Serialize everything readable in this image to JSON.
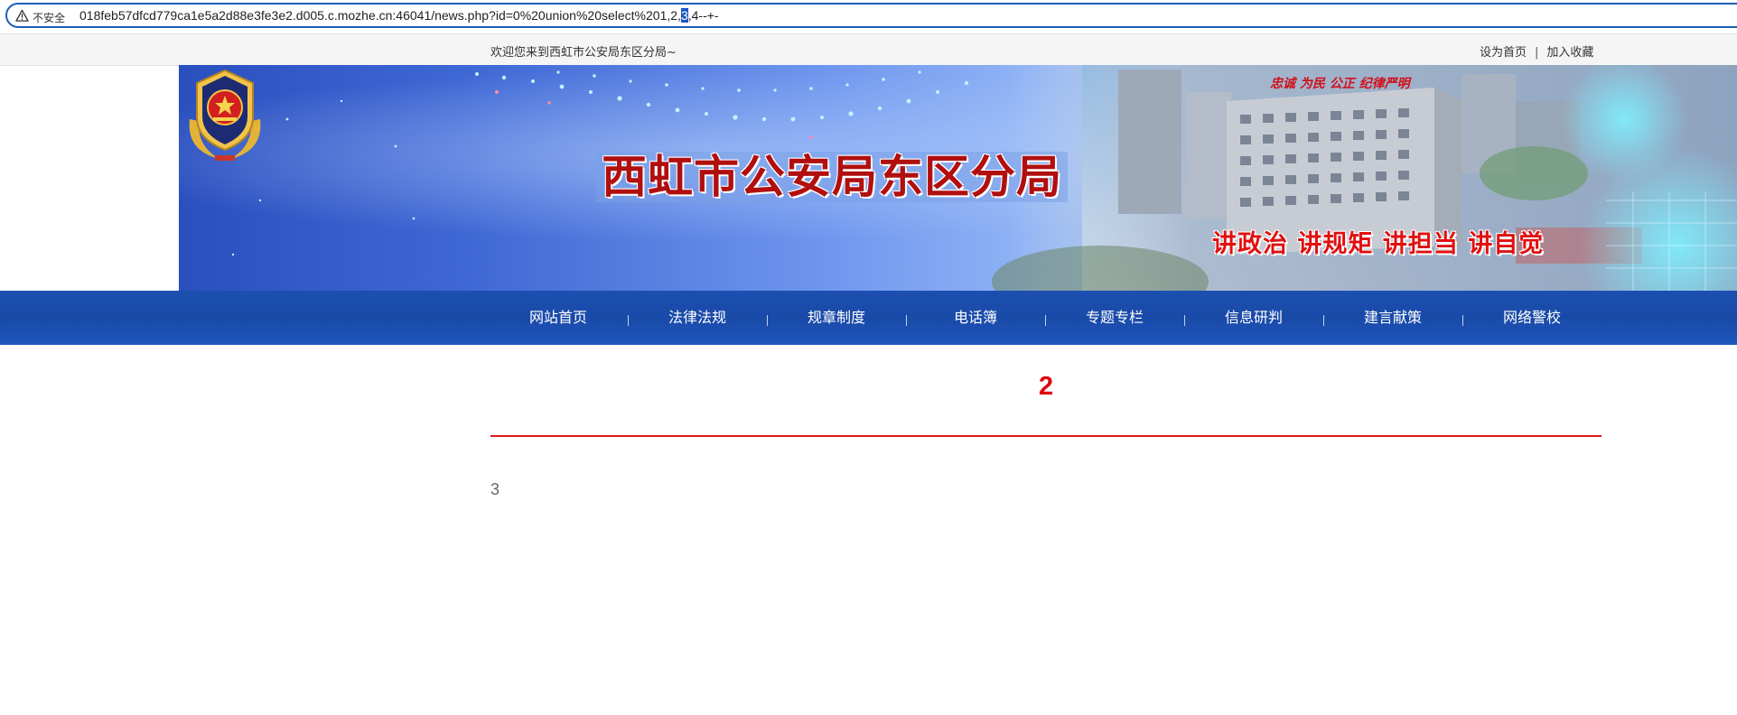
{
  "browser": {
    "security_label": "不安全",
    "url_before": "018feb57dfcd779ca1e5a2d88e3fe3e2.d005.c.mozhe.cn:46041/news.php?id=0%20union%20select%201,2,",
    "url_selected": "3",
    "url_after": ",4--+-"
  },
  "topbar": {
    "welcome": "欢迎您来到西虹市公安局东区分局~",
    "set_home": "设为首页",
    "separator": "|",
    "add_favorite": "加入收藏"
  },
  "banner": {
    "site_title": "西虹市公安局东区分局",
    "slogan": "讲政治 讲规矩 讲担当 讲自觉",
    "small_slogan": "忠诚 为民 公正 纪律严明"
  },
  "nav": {
    "items": [
      "网站首页",
      "法律法规",
      "规章制度",
      "电话簿",
      "专题专栏",
      "信息研判",
      "建言献策",
      "网络警校"
    ]
  },
  "article": {
    "title": "2",
    "body": "3"
  },
  "colors": {
    "nav_bg": "#1c4fb0",
    "title_red": "#e0000b",
    "url_border": "#1a5fb4"
  }
}
